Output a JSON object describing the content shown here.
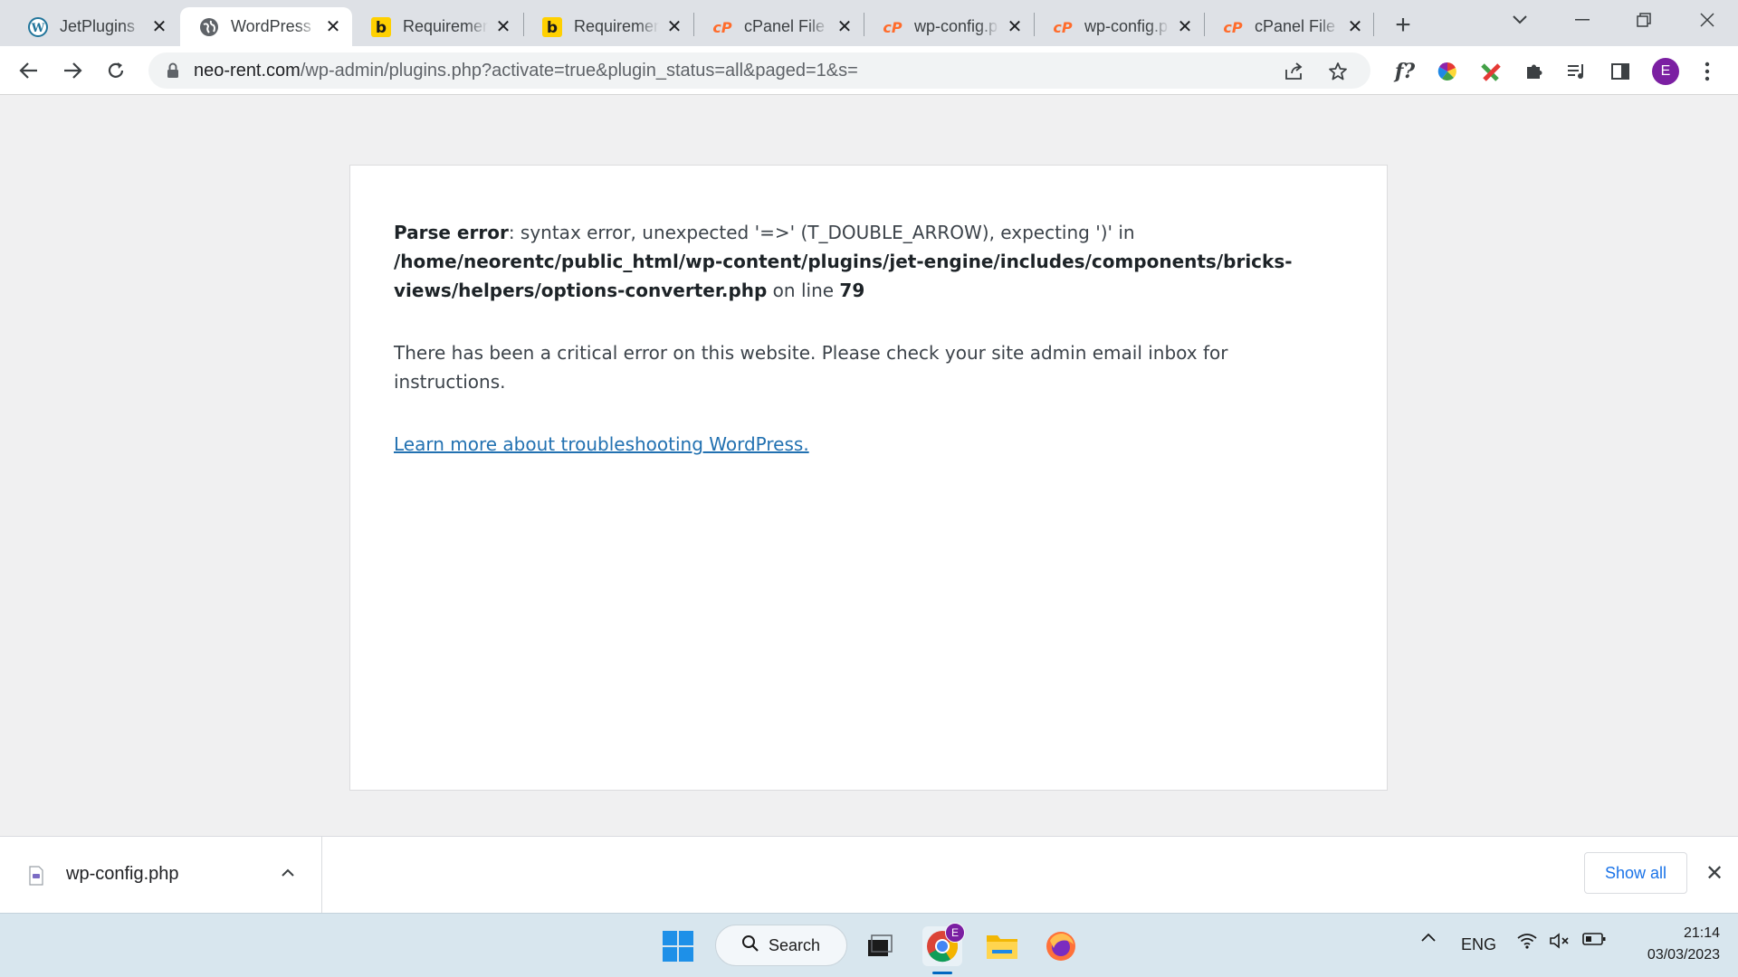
{
  "browser": {
    "tabs": [
      {
        "title": "JetPlugins",
        "icon": "wordpress-icon",
        "active": false
      },
      {
        "title": "WordPress",
        "icon": "globe-icon",
        "active": true
      },
      {
        "title": "Requiremen",
        "icon": "b-icon",
        "active": false
      },
      {
        "title": "Requiremen",
        "icon": "b-icon",
        "active": false
      },
      {
        "title": "cPanel File",
        "icon": "cpanel-icon",
        "active": false
      },
      {
        "title": "wp-config.p",
        "icon": "cpanel-icon",
        "active": false
      },
      {
        "title": "wp-config.p",
        "icon": "cpanel-icon",
        "active": false
      },
      {
        "title": "cPanel File",
        "icon": "cpanel-icon",
        "active": false
      }
    ],
    "address": {
      "host": "neo-rent.com",
      "path": "/wp-admin/plugins.php?activate=true&plugin_status=all&paged=1&s="
    },
    "profile_initial": "E",
    "extension_label": "f?"
  },
  "error_page": {
    "error_label": "Parse error",
    "error_message": ": syntax error, unexpected '=>' (T_DOUBLE_ARROW), expecting ')' in ",
    "file_path": "/home/neorentc/public_html/wp-content/plugins/jet-engine/includes/components/bricks-views/helpers/options-converter.php",
    "on_line_text": " on line ",
    "line_number": "79",
    "critical_message": "There has been a critical error on this website. Please check your site admin email inbox for instructions.",
    "learn_more_link": "Learn more about troubleshooting WordPress."
  },
  "downloads": {
    "file_name": "wp-config.php",
    "show_all_label": "Show all"
  },
  "taskbar": {
    "search_label": "Search",
    "language": "ENG",
    "time": "21:14",
    "date": "03/03/2023",
    "chrome_badge": "E"
  },
  "colors": {
    "wp_link": "#2271b1",
    "cpanel_orange": "#ff6c2c",
    "profile_purple": "#7b1fa2"
  }
}
